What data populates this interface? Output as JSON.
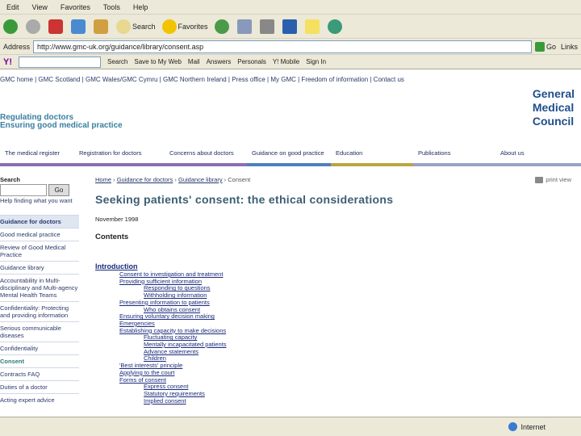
{
  "menubar": [
    "Edit",
    "View",
    "Favorites",
    "Tools",
    "Help"
  ],
  "toolbar": {
    "search_label": "Search",
    "favorites_label": "Favorites"
  },
  "addressbar": {
    "label": "Address",
    "url": "http://www.gmc-uk.org/guidance/library/consent.asp",
    "go_label": "Go",
    "links_label": "Links"
  },
  "yahoobar": {
    "search_label": "Search",
    "save_label": "Save to My Web",
    "mail_label": "Mail",
    "answers_label": "Answers",
    "personals_label": "Personals",
    "mobile_label": "Y! Mobile",
    "signin_label": "Sign In"
  },
  "site": {
    "toplinks": "GMC home | GMC Scotland | GMC Wales/GMC Cymru | GMC Northern Ireland | Press office | My GMC | Freedom of information | Contact us",
    "strap1": "Regulating doctors",
    "strap2": "Ensuring good medical practice",
    "logo": [
      "General",
      "Medical",
      "Council"
    ]
  },
  "nav": [
    {
      "label": "The medical register",
      "color": "#8a6fb0"
    },
    {
      "label": "Registration for doctors",
      "color": "#8a6fb0"
    },
    {
      "label": "Concerns about doctors",
      "color": "#8a6fb0"
    },
    {
      "label": "Guidance on good practice",
      "color": "#4f7fc0"
    },
    {
      "label": "Education",
      "color": "#b9a640"
    },
    {
      "label": "Publications",
      "color": "#9aa3c8"
    },
    {
      "label": "About us",
      "color": "#9aa3c8"
    }
  ],
  "left": {
    "search_label": "Search",
    "go_label": "Go",
    "find_label": "Help finding what you want",
    "items": [
      {
        "label": "Guidance for doctors",
        "kind": "head"
      },
      {
        "label": "Good medical practice",
        "kind": "item"
      },
      {
        "label": "Review of Good Medical Practice",
        "kind": "item"
      },
      {
        "label": "Guidance library",
        "kind": "item"
      },
      {
        "label": "Accountability in Multi-disciplinary and Multi-agency Mental Health Teams",
        "kind": "item"
      },
      {
        "label": "Confidentiality: Protecting and providing information",
        "kind": "item"
      },
      {
        "label": "Serious communicable diseases",
        "kind": "item"
      },
      {
        "label": "Confidentiality",
        "kind": "item"
      },
      {
        "label": "Consent",
        "kind": "active"
      },
      {
        "label": "Contracts FAQ",
        "kind": "item"
      },
      {
        "label": "Duties of a doctor",
        "kind": "item"
      },
      {
        "label": "Acting expert advice",
        "kind": "item"
      }
    ]
  },
  "content": {
    "breadcrumb": [
      "Home",
      "Guidance for doctors",
      "Guidance library",
      "Consent"
    ],
    "printview": "print view",
    "title": "Seeking patients' consent: the ethical considerations",
    "pubdate": "November 1998",
    "contents_head": "Contents",
    "toc": [
      {
        "label": "Introduction",
        "level": 0
      },
      {
        "label": "Consent to investigation and treatment",
        "level": 1
      },
      {
        "label": "Providing sufficient information",
        "level": 1
      },
      {
        "label": "Responding to questions",
        "level": 2
      },
      {
        "label": "Withholding information",
        "level": 2
      },
      {
        "label": "Presenting information to patients",
        "level": 1
      },
      {
        "label": "Who obtains consent",
        "level": 2
      },
      {
        "label": "Ensuring voluntary decision making",
        "level": 1
      },
      {
        "label": "Emergencies",
        "level": 1
      },
      {
        "label": "Establishing capacity to make decisions",
        "level": 1
      },
      {
        "label": "Fluctuating capacity",
        "level": 2
      },
      {
        "label": "Mentally incapacitated patients",
        "level": 2
      },
      {
        "label": "Advance statements",
        "level": 2
      },
      {
        "label": "Children",
        "level": 2
      },
      {
        "label": "'Best interests' principle",
        "level": 1
      },
      {
        "label": "Applying to the court",
        "level": 1
      },
      {
        "label": "Forms of consent",
        "level": 1
      },
      {
        "label": "Express consent",
        "level": 2
      },
      {
        "label": "Statutory requirements",
        "level": 2
      },
      {
        "label": "Implied consent",
        "level": 2
      }
    ]
  },
  "statusbar": {
    "zone": "Internet"
  }
}
